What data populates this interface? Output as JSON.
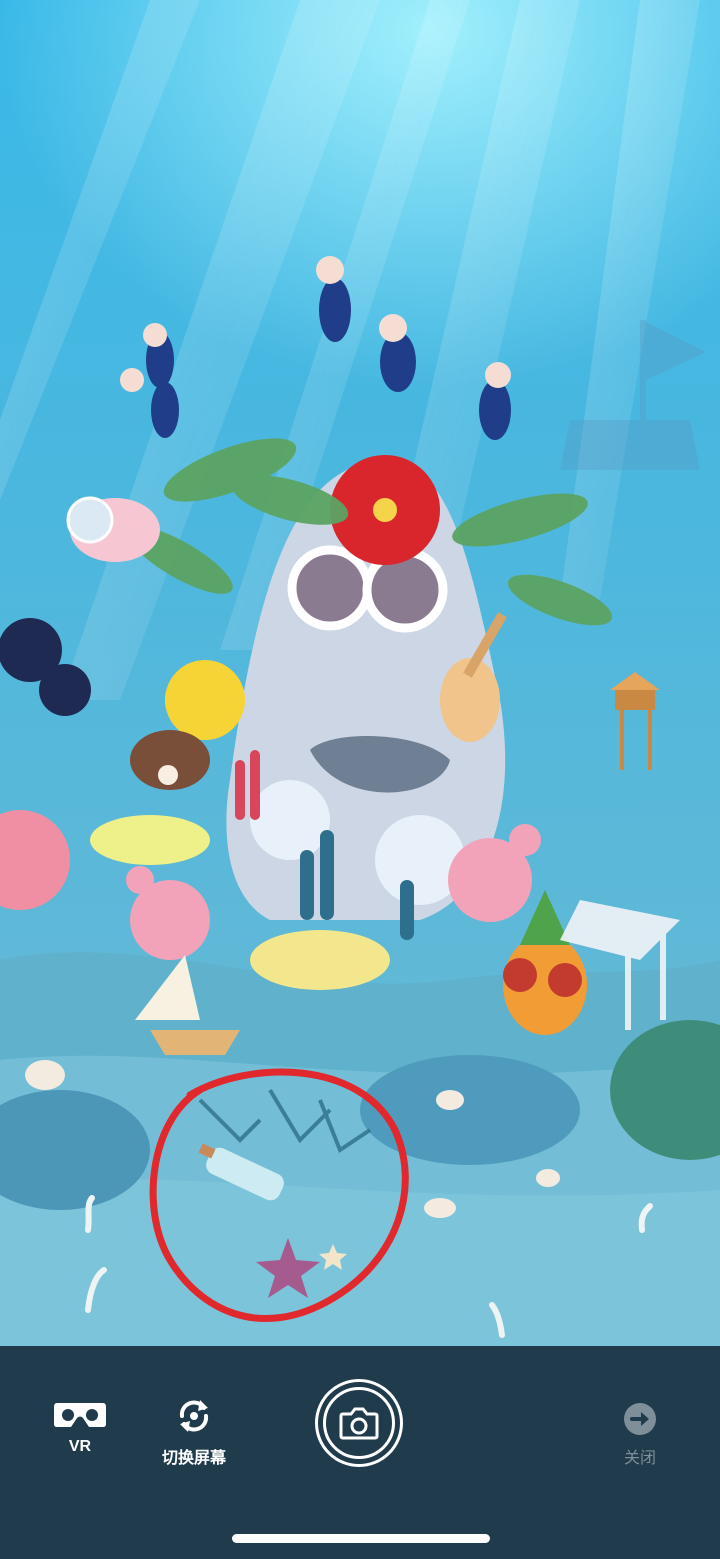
{
  "scene": {
    "description_icon": "aquarium-scene"
  },
  "toolbar": {
    "vr_label": "VR",
    "switch_label": "切换屏幕",
    "close_label": "关闭",
    "colors": {
      "background": "#203b4c",
      "active": "#ffffff",
      "disabled": "#7f8f99"
    }
  },
  "annotation": {
    "color": "#e0282d"
  }
}
